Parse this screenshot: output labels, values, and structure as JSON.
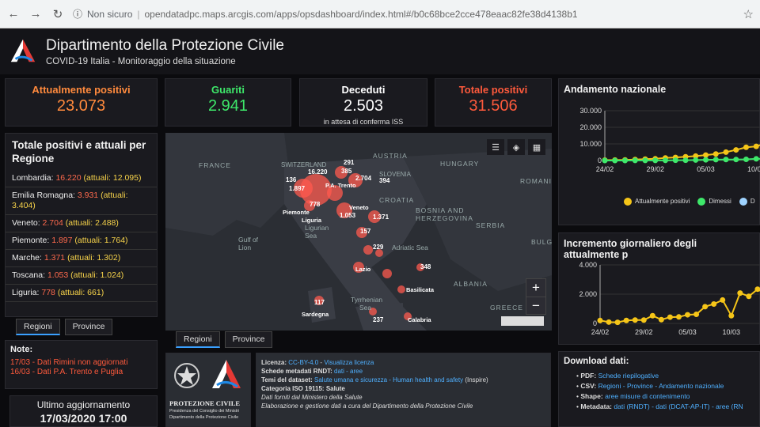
{
  "browser": {
    "info": "ⓘ",
    "not_secure": "Non sicuro",
    "url": "opendatadpc.maps.arcgis.com/apps/opsdashboard/index.html#/b0c68bce2cce478eaac82fe38d4138b1"
  },
  "header": {
    "title": "Dipartimento della Protezione Civile",
    "subtitle": "COVID-19 Italia - Monitoraggio della situazione"
  },
  "kpis": {
    "attualmente": {
      "label": "Attualmente positivi",
      "value": "23.073",
      "color": "#ff8a3d"
    },
    "guariti": {
      "label": "Guariti",
      "value": "2.941",
      "color": "#3ee86a"
    },
    "deceduti": {
      "label": "Deceduti",
      "value": "2.503",
      "note": "in attesa di conferma ISS",
      "color": "#ffffff"
    },
    "totale": {
      "label": "Totale positivi",
      "value": "31.506",
      "color": "#ff5a3c"
    }
  },
  "regions": {
    "title": "Totale positivi e attuali per Regione",
    "items": [
      {
        "name": "Lombardia:",
        "total": "16.220",
        "actual": "(attuali: 12.095)"
      },
      {
        "name": "Emilia Romagna:",
        "total": "3.931",
        "actual": "(attuali: 3.404)"
      },
      {
        "name": "Veneto:",
        "total": "2.704",
        "actual": "(attuali: 2.488)"
      },
      {
        "name": "Piemonte:",
        "total": "1.897",
        "actual": "(attuali: 1.764)"
      },
      {
        "name": "Marche:",
        "total": "1.371",
        "actual": "(attuali: 1.302)"
      },
      {
        "name": "Toscana:",
        "total": "1.053",
        "actual": "(attuali: 1.024)"
      },
      {
        "name": "Liguria:",
        "total": "778",
        "actual": "(attuali: 661)"
      }
    ],
    "tabs": [
      "Regioni",
      "Province"
    ]
  },
  "map": {
    "labels": [
      "FRANCE",
      "SWITZERLAND",
      "AUSTRIA",
      "HUNGARY",
      "SLOVENIA",
      "CROATIA",
      "ROMANI",
      "BOSNIA AND",
      "HERZEGOVINA",
      "SERBIA",
      "Gulf of",
      "Lion",
      "Ligurian",
      "Sea",
      "Adriatic Sea",
      "BULG",
      "ALBANIA",
      "GREECE",
      "Tyrrhenian",
      "Sea",
      "Piemonte",
      "Liguria",
      "Veneto",
      "Lazio",
      "Sardegna",
      "Calabria",
      "Basilicata",
      "P.A. Trento"
    ],
    "numbers": [
      "291",
      "16.220",
      "385",
      "2.704",
      "394",
      "136",
      "1.897",
      "778",
      "1.053",
      "1.371",
      "157",
      "117",
      "237",
      "348",
      "229"
    ],
    "tabs": [
      "Regioni",
      "Province"
    ],
    "zoom_in": "+",
    "zoom_out": "−"
  },
  "chart1": {
    "title": "Andamento nazionale",
    "legend": [
      "Attualmente positivi",
      "Dimessi",
      "D"
    ],
    "legend_colors": [
      "#f5c518",
      "#3ee86a",
      "#9fd3ff"
    ]
  },
  "chart2": {
    "title": "Incremento giornaliero degli attualmente p"
  },
  "chart_data": [
    {
      "type": "line",
      "title": "Andamento nazionale",
      "x": [
        "24/02",
        "25/02",
        "26/02",
        "27/02",
        "28/02",
        "29/02",
        "01/03",
        "02/03",
        "03/03",
        "04/03",
        "05/03",
        "06/03",
        "07/03",
        "08/03",
        "09/03",
        "10/03",
        "11/03"
      ],
      "xticks": [
        "24/02",
        "29/02",
        "05/03",
        "10/03"
      ],
      "yticks": [
        "30.000",
        "20.000",
        "10.000",
        "0"
      ],
      "ylim": [
        0,
        30000
      ],
      "series": [
        {
          "name": "Attualmente positivi",
          "values": [
            221,
            311,
            385,
            588,
            821,
            1049,
            1577,
            1835,
            2263,
            2706,
            3296,
            3916,
            5061,
            6387,
            7985,
            8514,
            10590
          ]
        },
        {
          "name": "Dimessi",
          "values": [
            1,
            1,
            3,
            45,
            46,
            46,
            83,
            149,
            160,
            276,
            414,
            523,
            589,
            622,
            724,
            1004,
            1045
          ]
        }
      ],
      "colors": [
        "#f5c518",
        "#3ee86a"
      ]
    },
    {
      "type": "line",
      "title": "Incremento giornaliero degli attualmente p",
      "x": [
        "24/02",
        "25/02",
        "26/02",
        "27/02",
        "28/02",
        "29/02",
        "01/03",
        "02/03",
        "03/03",
        "04/03",
        "05/03",
        "06/03",
        "07/03",
        "08/03",
        "09/03",
        "10/03",
        "11/03",
        "12/03",
        "13/03",
        "14/03"
      ],
      "xticks": [
        "24/02",
        "29/02",
        "05/03",
        "10/03"
      ],
      "yticks": [
        "4.000",
        "2.000",
        "0"
      ],
      "ylim": [
        0,
        4000
      ],
      "series": [
        {
          "name": "",
          "values": [
            200,
            90,
            74,
            203,
            233,
            228,
            528,
            258,
            428,
            443,
            590,
            620,
            1145,
            1326,
            1598,
            529,
            2076,
            1850,
            2340,
            2000
          ]
        }
      ],
      "colors": [
        "#f5c518"
      ]
    }
  ],
  "notes": {
    "title": "Note:",
    "lines": [
      "17/03 - Dati Rimini non aggiornati",
      "16/03 - Dati P.A. Trento e Puglia"
    ]
  },
  "update": {
    "label": "Ultimo aggiornamento",
    "value": "17/03/2020 17:00"
  },
  "logos": {
    "protezione": "PROTEZIONE CIVILE",
    "sub1": "Presidenza del Consiglio dei Ministri",
    "sub2": "Dipartimento della Protezione Civile"
  },
  "license": {
    "licenza_label": "Licenza:",
    "licenza_value": "CC-BY-4.0",
    "licenza_link": "Visualizza licenza",
    "schede_label": "Schede metadati RNDT:",
    "schede_value": "dati - aree",
    "temi_label": "Temi del dataset:",
    "temi_value": "Salute umana e sicurezza - Human health and safety",
    "temi_suffix": "(Inspire)",
    "categoria": "Categoria ISO 19115: Salute",
    "fonte": "Dati forniti dal Ministero della Salute",
    "elaborazione": "Elaborazione e gestione dati a cura del Dipartimento della Protezione Civile"
  },
  "download": {
    "title": "Download dati:",
    "pdf_label": "PDF:",
    "pdf_value": "Schede riepilogative",
    "csv_label": "CSV:",
    "csv_value": "Regioni - Province - Andamento nazionale",
    "shape_label": "Shape:",
    "shape_value": "aree misure di contenimento",
    "meta_label": "Metadata:",
    "meta_value": "dati (RNDT) - dati (DCAT-AP-IT) - aree (RN"
  }
}
